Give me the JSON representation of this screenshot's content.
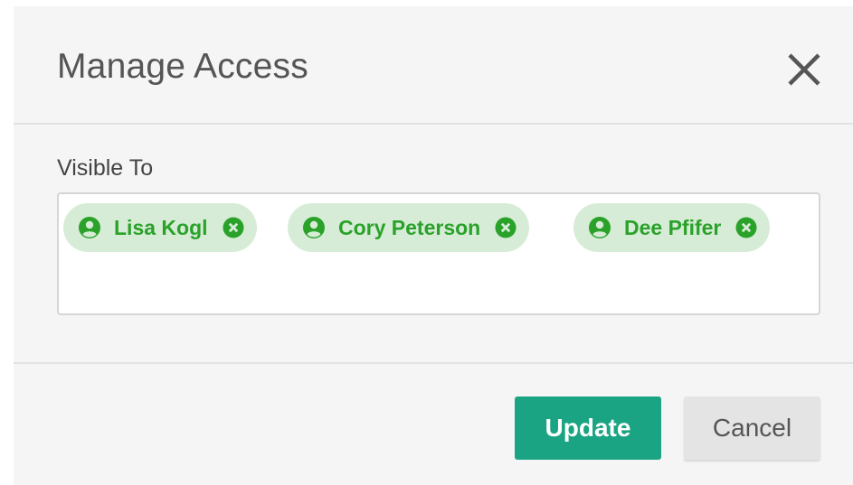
{
  "dialog": {
    "title": "Manage Access",
    "close_icon": "close-icon"
  },
  "visible_to": {
    "label": "Visible To",
    "users": [
      {
        "name": "Lisa Kogl",
        "icon": "user-circle-icon",
        "remove_icon": "remove-circle-icon"
      },
      {
        "name": "Cory Peterson",
        "icon": "user-circle-icon",
        "remove_icon": "remove-circle-icon"
      },
      {
        "name": "Dee Pfifer",
        "icon": "user-circle-icon",
        "remove_icon": "remove-circle-icon"
      }
    ]
  },
  "actions": {
    "update_label": "Update",
    "cancel_label": "Cancel"
  },
  "colors": {
    "primary": "#1aa484",
    "tag_bg": "#d7ecd6",
    "tag_text": "#2aa22a"
  }
}
